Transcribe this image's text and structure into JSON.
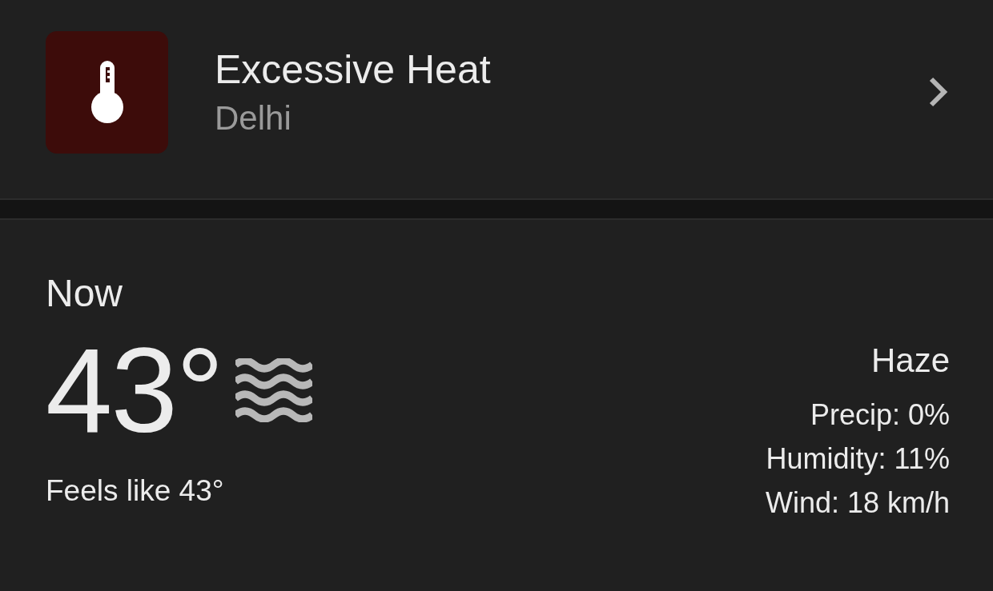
{
  "alert": {
    "title": "Excessive Heat",
    "location": "Delhi",
    "color": "#3d0c0a"
  },
  "current": {
    "heading": "Now",
    "temperature": "43°",
    "feels_like": "Feels like 43°",
    "condition": "Haze",
    "details": [
      {
        "label": "Precip:",
        "value": "0%"
      },
      {
        "label": "Humidity:",
        "value": "11%"
      },
      {
        "label": "Wind:",
        "value": "18 km/h"
      }
    ]
  }
}
